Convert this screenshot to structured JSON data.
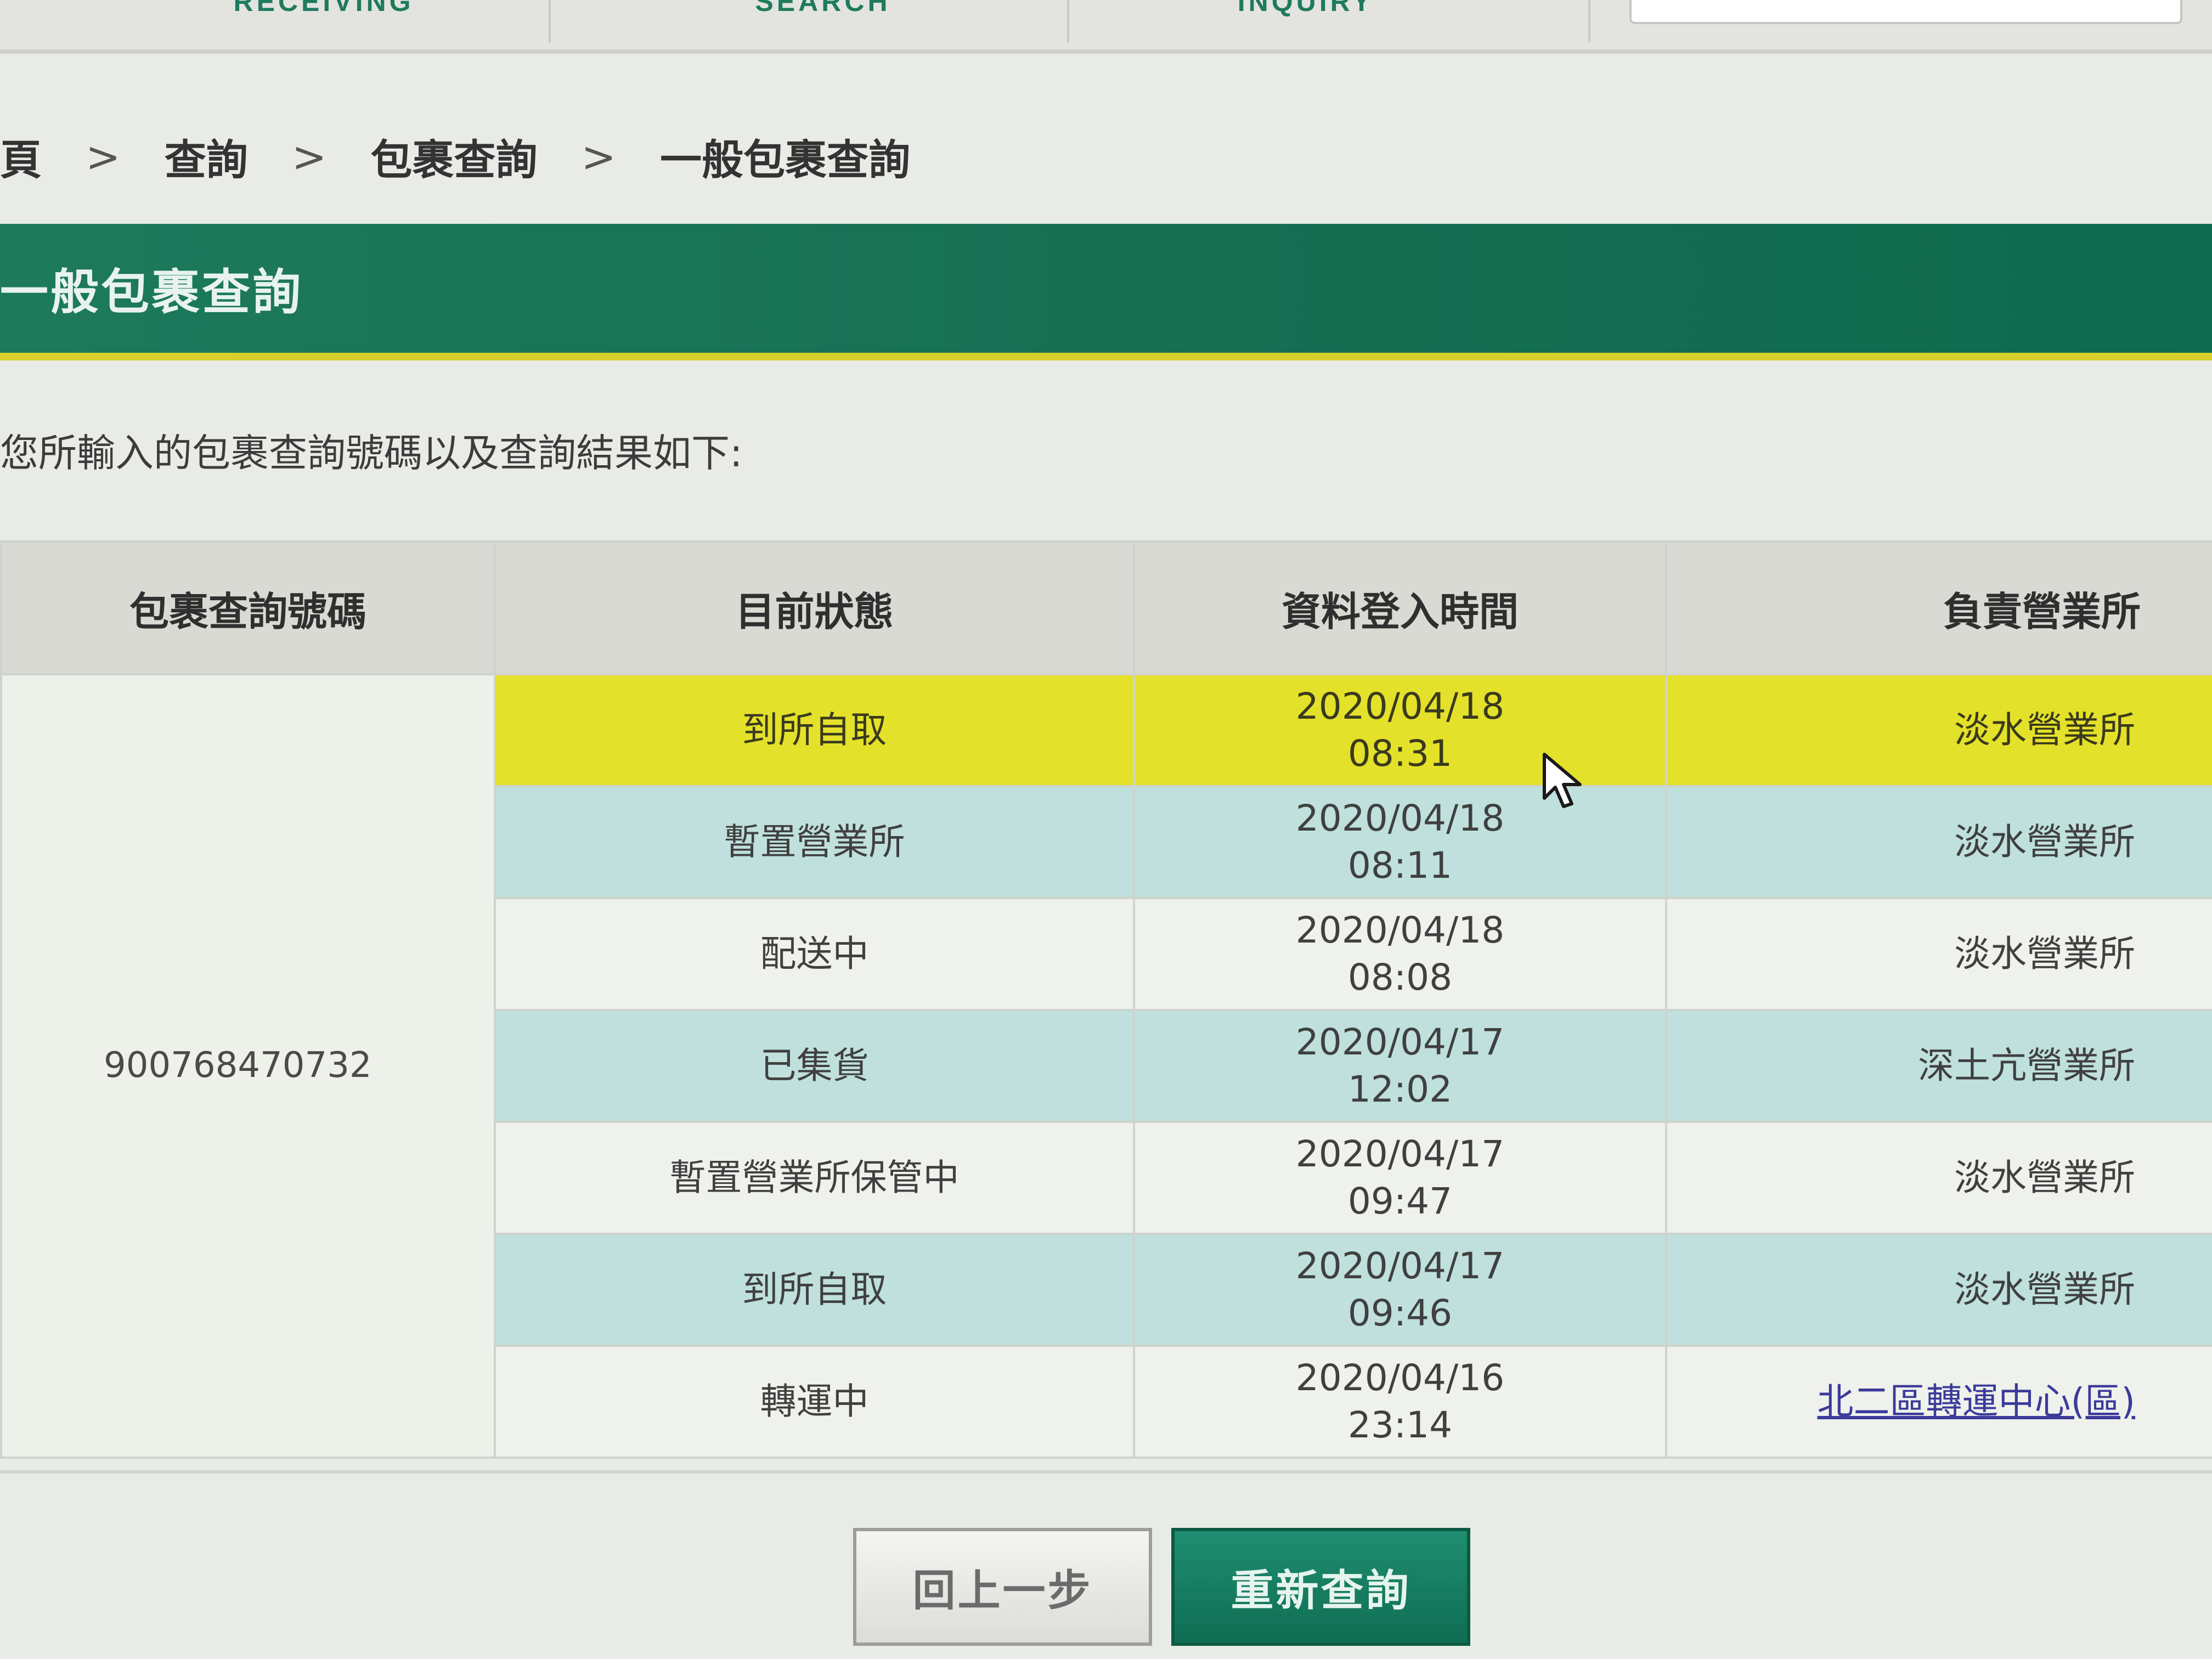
{
  "nav": {
    "items": [
      "RECEIVING",
      "SEARCH",
      "INQUIRY"
    ]
  },
  "breadcrumb": {
    "items": [
      "頁",
      "查詢",
      "包裹查詢",
      "一般包裹查詢"
    ],
    "separator": ">"
  },
  "header": {
    "title": "一般包裹查詢"
  },
  "intro": {
    "text": "您所輸入的包裹查詢號碼以及查詢結果如下:"
  },
  "table": {
    "headers": [
      "包裹查詢號碼",
      "目前狀態",
      "資料登入時間",
      "負責營業所"
    ],
    "tracking_number": "900768470732",
    "rows": [
      {
        "status": "到所自取",
        "date": "2020/04/18",
        "time": "08:31",
        "office": "淡水營業所"
      },
      {
        "status": "暫置營業所",
        "date": "2020/04/18",
        "time": "08:11",
        "office": "淡水營業所"
      },
      {
        "status": "配送中",
        "date": "2020/04/18",
        "time": "08:08",
        "office": "淡水營業所"
      },
      {
        "status": "已集貨",
        "date": "2020/04/17",
        "time": "12:02",
        "office": "深土亢營業所"
      },
      {
        "status": "暫置營業所保管中",
        "date": "2020/04/17",
        "time": "09:47",
        "office": "淡水營業所"
      },
      {
        "status": "到所自取",
        "date": "2020/04/17",
        "time": "09:46",
        "office": "淡水營業所"
      },
      {
        "status": "轉運中",
        "date": "2020/04/16",
        "time": "23:14",
        "office": "北二區轉運中心(區)"
      }
    ]
  },
  "buttons": {
    "back": "回上一步",
    "requery": "重新查詢"
  },
  "colors": {
    "brand_green": "#176f52",
    "accent_yellow": "#e4e12a",
    "row_teal": "#bfe0dc",
    "link": "#3b3b9a"
  }
}
